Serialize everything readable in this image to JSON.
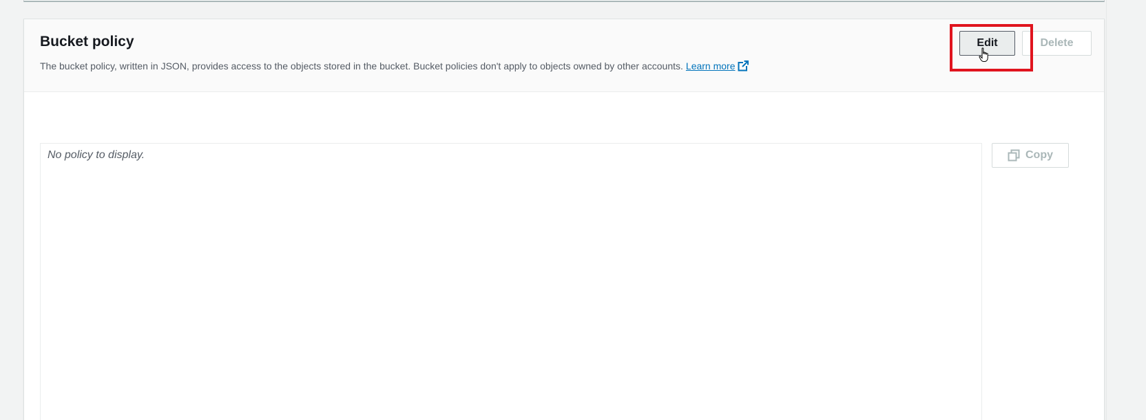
{
  "section": {
    "title": "Bucket policy",
    "description": "The bucket policy, written in JSON, provides access to the objects stored in the bucket. Bucket policies don't apply to objects owned by other accounts.",
    "learn_more_label": "Learn more",
    "learn_more_icon": "external-link-icon"
  },
  "actions": {
    "edit_label": "Edit",
    "delete_label": "Delete"
  },
  "policy": {
    "empty_text": "No policy to display.",
    "copy_label": "Copy",
    "copy_icon": "copy-icon"
  },
  "colors": {
    "link": "#0073bb",
    "highlight": "#e0141e",
    "disabled_text": "#aab7b8",
    "header_bg": "#fafafa",
    "page_bg": "#f2f3f3"
  },
  "cursor": "hand-pointer-icon"
}
